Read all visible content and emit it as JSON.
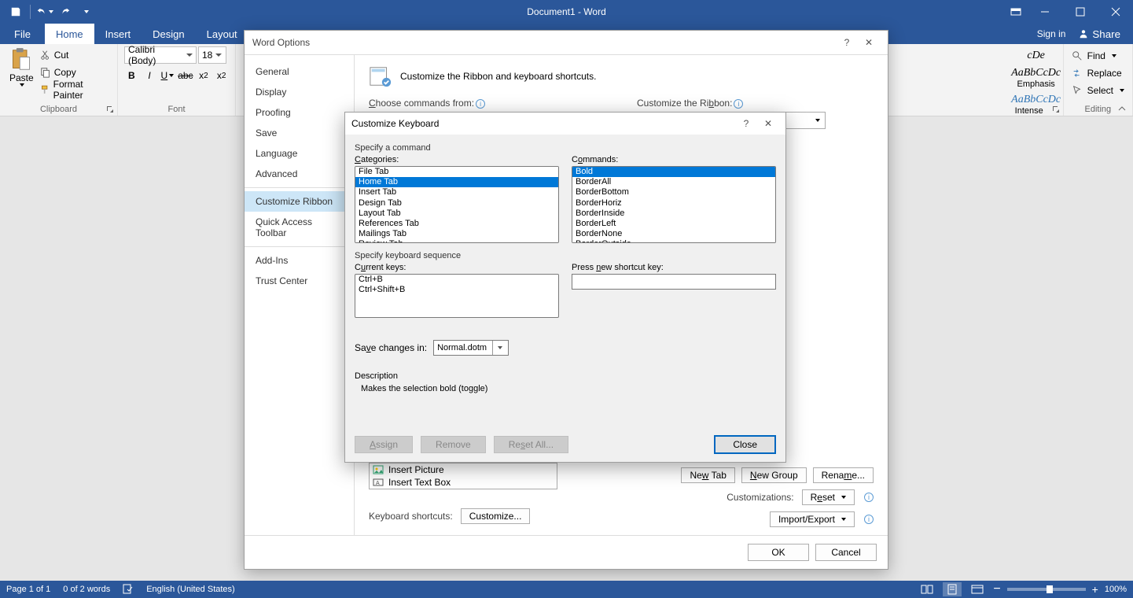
{
  "titlebar": {
    "title": "Document1 - Word"
  },
  "tabs": {
    "file": "File",
    "items": [
      "Home",
      "Insert",
      "Design",
      "Layout"
    ],
    "signin": "Sign in",
    "share": "Share"
  },
  "ribbon": {
    "clipboard": {
      "label": "Clipboard",
      "paste": "Paste",
      "cut": "Cut",
      "copy": "Copy",
      "formatPainter": "Format Painter"
    },
    "font": {
      "label": "Font",
      "name": "Calibri (Body)",
      "size": "18"
    },
    "styles": {
      "items": [
        {
          "preview": "cDe",
          "name": ""
        },
        {
          "preview": "AaBbCcDc",
          "name": "Emphasis"
        },
        {
          "preview": "AaBbCcDc",
          "name": "Intense E..."
        }
      ]
    },
    "editing": {
      "label": "Editing",
      "find": "Find",
      "replace": "Replace",
      "select": "Select"
    }
  },
  "optionsDialog": {
    "title": "Word Options",
    "nav": [
      "General",
      "Display",
      "Proofing",
      "Save",
      "Language",
      "Advanced",
      "Customize Ribbon",
      "Quick Access Toolbar",
      "Add-Ins",
      "Trust Center"
    ],
    "selectedNav": "Customize Ribbon",
    "headerText": "Customize the Ribbon and keyboard shortcuts.",
    "chooseFrom": "Choose commands from:",
    "customizeRibbon": "Customize the Ribbon:",
    "keyboardShortcutsLabel": "Keyboard shortcuts:",
    "customizeBtn": "Customize...",
    "newTab": "New Tab",
    "newGroup": "New Group",
    "rename": "Rename...",
    "customizations": "Customizations:",
    "reset": "Reset",
    "importExport": "Import/Export",
    "insertItems": [
      "Insert Picture",
      "Insert Text Box"
    ],
    "ok": "OK",
    "cancel": "Cancel"
  },
  "ckDialog": {
    "title": "Customize Keyboard",
    "specifyCommand": "Specify a command",
    "categoriesLabel": "Categories:",
    "commandsLabel": "Commands:",
    "categories": [
      "File Tab",
      "Home Tab",
      "Insert Tab",
      "Design Tab",
      "Layout Tab",
      "References Tab",
      "Mailings Tab",
      "Review Tab"
    ],
    "selectedCategory": "Home Tab",
    "commands": [
      "Bold",
      "BorderAll",
      "BorderBottom",
      "BorderHoriz",
      "BorderInside",
      "BorderLeft",
      "BorderNone",
      "BorderOutside"
    ],
    "selectedCommand": "Bold",
    "specifySequence": "Specify keyboard sequence",
    "currentKeysLabel": "Current keys:",
    "currentKeys": [
      "Ctrl+B",
      "Ctrl+Shift+B"
    ],
    "pressNewLabel": "Press new shortcut key:",
    "saveChangesIn": "Save changes in:",
    "saveTarget": "Normal.dotm",
    "descriptionLabel": "Description",
    "descriptionText": "Makes the selection bold (toggle)",
    "assign": "Assign",
    "remove": "Remove",
    "resetAll": "Reset All...",
    "close": "Close"
  },
  "statusbar": {
    "page": "Page 1 of 1",
    "words": "0 of 2 words",
    "language": "English (United States)",
    "zoom": "100%"
  }
}
